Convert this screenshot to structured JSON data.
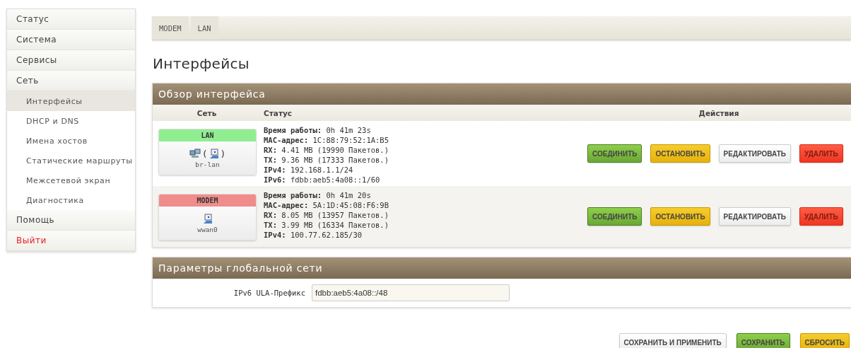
{
  "sidebar": {
    "items": [
      {
        "label": "Статус",
        "selected": false
      },
      {
        "label": "Система",
        "selected": false
      },
      {
        "label": "Сервисы",
        "selected": false
      },
      {
        "label": "Сеть",
        "selected": false,
        "children": [
          {
            "label": "Интерфейсы",
            "selected": true
          },
          {
            "label": "DHCP и DNS",
            "selected": false
          },
          {
            "label": "Имена хостов",
            "selected": false
          },
          {
            "label": "Статические маршруты",
            "selected": false
          },
          {
            "label": "Межсетевой экран",
            "selected": false
          },
          {
            "label": "Диагностика",
            "selected": false
          }
        ]
      },
      {
        "label": "Помощь",
        "selected": false
      },
      {
        "label": "Выйти",
        "selected": false,
        "kind": "logout"
      }
    ]
  },
  "tabs": [
    {
      "label": "MODEM",
      "selected": false
    },
    {
      "label": "LAN",
      "selected": false
    }
  ],
  "title": "Интерфейсы",
  "overview": {
    "title": "Обзор интерфейса",
    "columns": [
      "Сеть",
      "Статус",
      "Действия"
    ],
    "interfaces": [
      {
        "name": "LAN",
        "color": "#90ee90",
        "icons": [
          {
            "kind": "bridge"
          },
          {
            "kind": "text",
            "text": "("
          },
          {
            "kind": "port"
          },
          {
            "kind": "text",
            "text": ")"
          }
        ],
        "device": "br-lan",
        "status": [
          "**Время работы:** 0h 41m 23s",
          "**MAC-адрес:** 1C:88:79:52:1A:B5",
          "**RX:** 4.41 MB (19990 Пакетов.)",
          "**TX:** 9.36 MB (17333 Пакетов.)",
          "**IPv4:** 192.168.1.1/24",
          "**IPv6:** fdbb:aeb5:4a08::1/60"
        ],
        "actions": [
          {
            "label": "СОЕДИНИТЬ",
            "kind": "connect"
          },
          {
            "label": "ОСТАНОВИТЬ",
            "kind": "stop"
          },
          {
            "label": "РЕДАКТИРОВАТЬ",
            "kind": "edit"
          },
          {
            "label": "УДАЛИТЬ",
            "kind": "delete"
          }
        ]
      },
      {
        "name": "MODEM",
        "color": "#f08c8c",
        "icons": [
          {
            "kind": "port"
          }
        ],
        "device": "wwan0",
        "status": [
          "**Время работы:** 0h 41m 20s",
          "**MAC-адрес:** 5A:1D:45:08:F6:9B",
          "**RX:** 8.05 MB (13957 Пакетов.)",
          "**TX:** 3.99 MB (16334 Пакетов.)",
          "**IPv4:** 100.77.62.185/30"
        ],
        "actions": [
          {
            "label": "СОЕДИНИТЬ",
            "kind": "connect"
          },
          {
            "label": "ОСТАНОВИТЬ",
            "kind": "stop"
          },
          {
            "label": "РЕДАКТИРОВАТЬ",
            "kind": "edit"
          },
          {
            "label": "УДАЛИТЬ",
            "kind": "delete"
          }
        ]
      }
    ]
  },
  "global": {
    "title": "Параметры глобальной сети",
    "field": {
      "label": "IPv6 ULA-Префикс",
      "value": "fdbb:aeb5:4a08::/48"
    }
  },
  "footer_buttons": [
    {
      "label": "СОХРАНИТЬ И ПРИМЕНИТЬ",
      "kind": "apply"
    },
    {
      "label": "СОХРАНИТЬ",
      "kind": "save"
    },
    {
      "label": "СБРОСИТЬ",
      "kind": "reset"
    }
  ]
}
